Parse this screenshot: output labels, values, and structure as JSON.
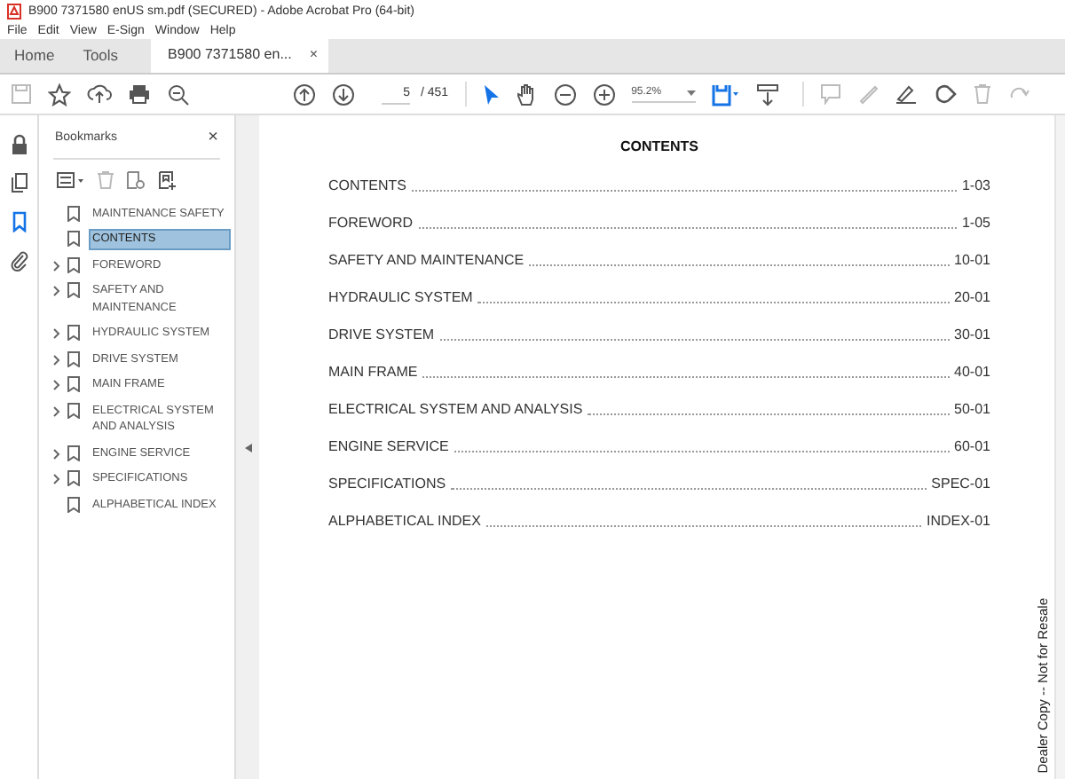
{
  "window": {
    "title": "B900 7371580 enUS sm.pdf (SECURED) - Adobe Acrobat Pro (64-bit)"
  },
  "menu": [
    "File",
    "Edit",
    "View",
    "E-Sign",
    "Window",
    "Help"
  ],
  "tabs": [
    {
      "label": "Home",
      "selected": false
    },
    {
      "label": "Tools",
      "selected": false
    },
    {
      "label": "B900 7371580 en...",
      "selected": true,
      "close": "×"
    }
  ],
  "toolbar": {
    "page_number": "5",
    "page_total": "/ 451",
    "zoom": "95.2%"
  },
  "nav_panel": [
    {
      "kind": "lock",
      "selected": false
    },
    {
      "kind": "pages",
      "selected": false
    },
    {
      "kind": "bookmarks",
      "selected": true
    },
    {
      "kind": "attachments",
      "selected": false
    }
  ],
  "bookmarks": {
    "title": "Bookmarks",
    "close": "×",
    "items": [
      {
        "label": "MAINTENANCE SAFETY",
        "expandable": false,
        "selected": false
      },
      {
        "label": "CONTENTS",
        "expandable": false,
        "selected": true
      },
      {
        "label": "FOREWORD",
        "expandable": true,
        "selected": false
      },
      {
        "label": "SAFETY AND MAINTENANCE",
        "expandable": true,
        "selected": false
      },
      {
        "label": "HYDRAULIC SYSTEM",
        "expandable": true,
        "selected": false
      },
      {
        "label": "DRIVE SYSTEM",
        "expandable": true,
        "selected": false
      },
      {
        "label": "MAIN FRAME",
        "expandable": true,
        "selected": false
      },
      {
        "label": "ELECTRICAL SYSTEM AND ANALYSIS",
        "expandable": true,
        "selected": false
      },
      {
        "label": "ENGINE SERVICE",
        "expandable": true,
        "selected": false
      },
      {
        "label": "SPECIFICATIONS",
        "expandable": true,
        "selected": false
      },
      {
        "label": "ALPHABETICAL INDEX",
        "expandable": false,
        "selected": false
      }
    ]
  },
  "document": {
    "heading": "CONTENTS",
    "entries": [
      {
        "title": "CONTENTS",
        "page": "1-03"
      },
      {
        "title": "FOREWORD",
        "page": "1-05"
      },
      {
        "title": "SAFETY AND MAINTENANCE",
        "page": "10-01"
      },
      {
        "title": "HYDRAULIC SYSTEM",
        "page": "20-01"
      },
      {
        "title": "DRIVE SYSTEM",
        "page": "30-01"
      },
      {
        "title": "MAIN FRAME",
        "page": "40-01"
      },
      {
        "title": "ELECTRICAL SYSTEM AND ANALYSIS",
        "page": "50-01"
      },
      {
        "title": "ENGINE SERVICE",
        "page": "60-01"
      },
      {
        "title": "SPECIFICATIONS",
        "page": "SPEC-01"
      },
      {
        "title": "ALPHABETICAL INDEX",
        "page": "INDEX-01"
      }
    ],
    "side_note": "Dealer Copy -- Not for Resale"
  }
}
